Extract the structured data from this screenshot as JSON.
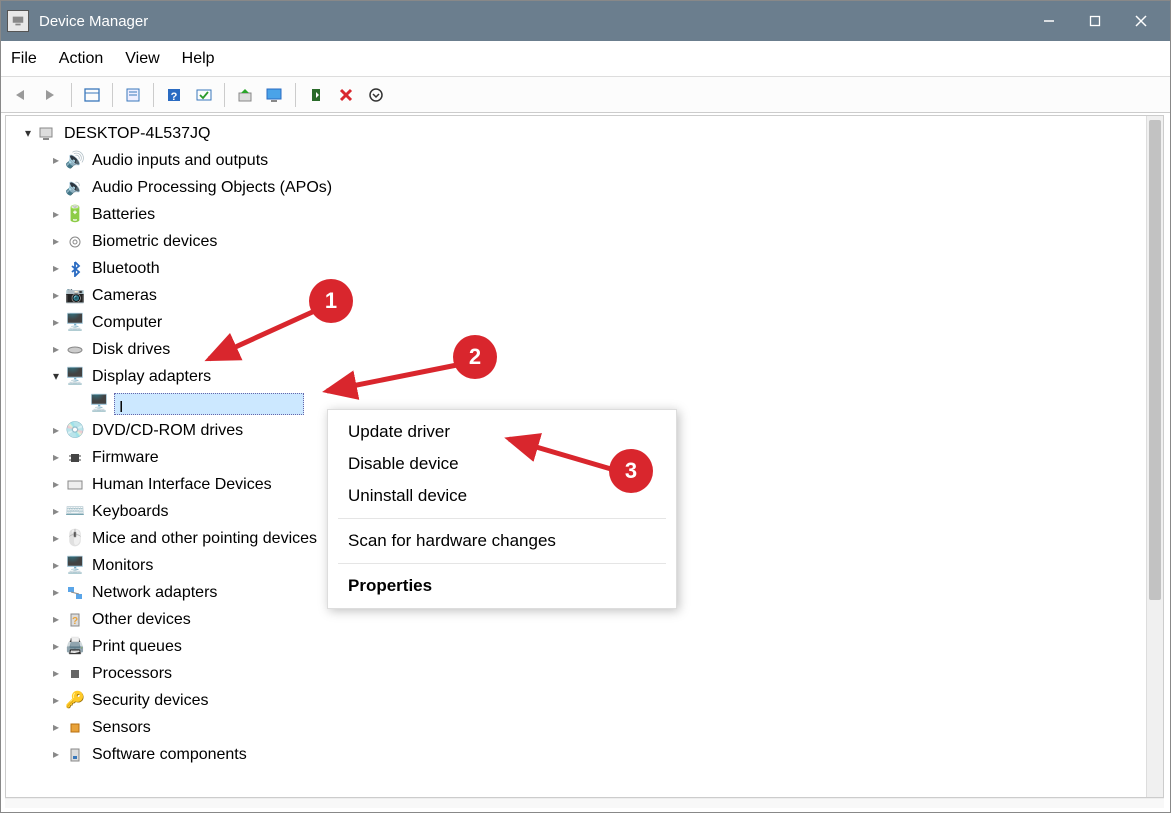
{
  "window": {
    "title": "Device Manager"
  },
  "menu": {
    "file": "File",
    "action": "Action",
    "view": "View",
    "help": "Help"
  },
  "tree": {
    "root": "DESKTOP-4L537JQ",
    "items": [
      "Audio inputs and outputs",
      "Audio Processing Objects (APOs)",
      "Batteries",
      "Biometric devices",
      "Bluetooth",
      "Cameras",
      "Computer",
      "Disk drives",
      "Display adapters",
      "DVD/CD-ROM drives",
      "Firmware",
      "Human Interface Devices",
      "Keyboards",
      "Mice and other pointing devices",
      "Monitors",
      "Network adapters",
      "Other devices",
      "Print queues",
      "Processors",
      "Security devices",
      "Sensors",
      "Software components"
    ],
    "selected_child_prefix": "I"
  },
  "context": {
    "update": "Update driver",
    "disable": "Disable device",
    "uninstall": "Uninstall device",
    "scan": "Scan for hardware changes",
    "properties": "Properties"
  },
  "annotations": {
    "n1": "1",
    "n2": "2",
    "n3": "3"
  }
}
